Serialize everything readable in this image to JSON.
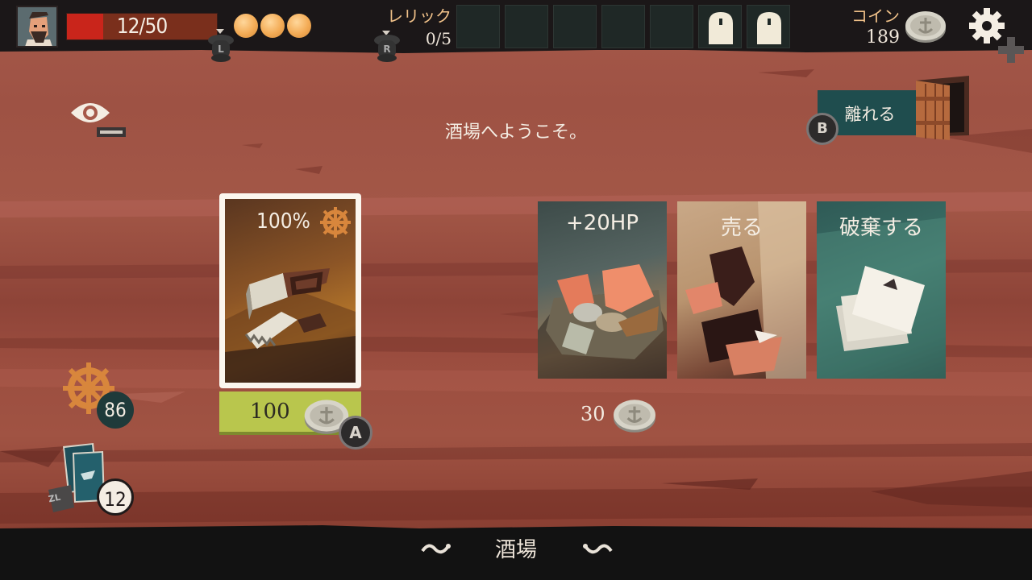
{
  "player": {
    "hp_text": "12/50",
    "hp_current": 12,
    "hp_max": 50,
    "energy_orbs": 3
  },
  "controls": {
    "left_bumper": "L",
    "right_bumper": "R",
    "zl": "ZL",
    "a_button": "A",
    "b_button": "B"
  },
  "relics": {
    "label": "レリック",
    "count": "0/5",
    "slots_total": 7,
    "slots_locked": 2
  },
  "coins": {
    "label": "コイン",
    "count": "189"
  },
  "header": {
    "welcome_text": "酒場へようこそ。",
    "leave_label": "離れる"
  },
  "shop": {
    "item_percent": "100%",
    "item_price": "100",
    "services": [
      {
        "title": "+20HP"
      },
      {
        "title": "売る"
      },
      {
        "title": "破棄する"
      }
    ],
    "service_price": "30"
  },
  "status": {
    "wheel_count": "86",
    "deck_count": "12"
  },
  "footer": {
    "location": "酒場"
  },
  "colors": {
    "hp_fill": "#c9251b",
    "price_button": "#b9c64d",
    "leave_button": "#1f4d4e",
    "accent_gold": "#f0c189"
  }
}
